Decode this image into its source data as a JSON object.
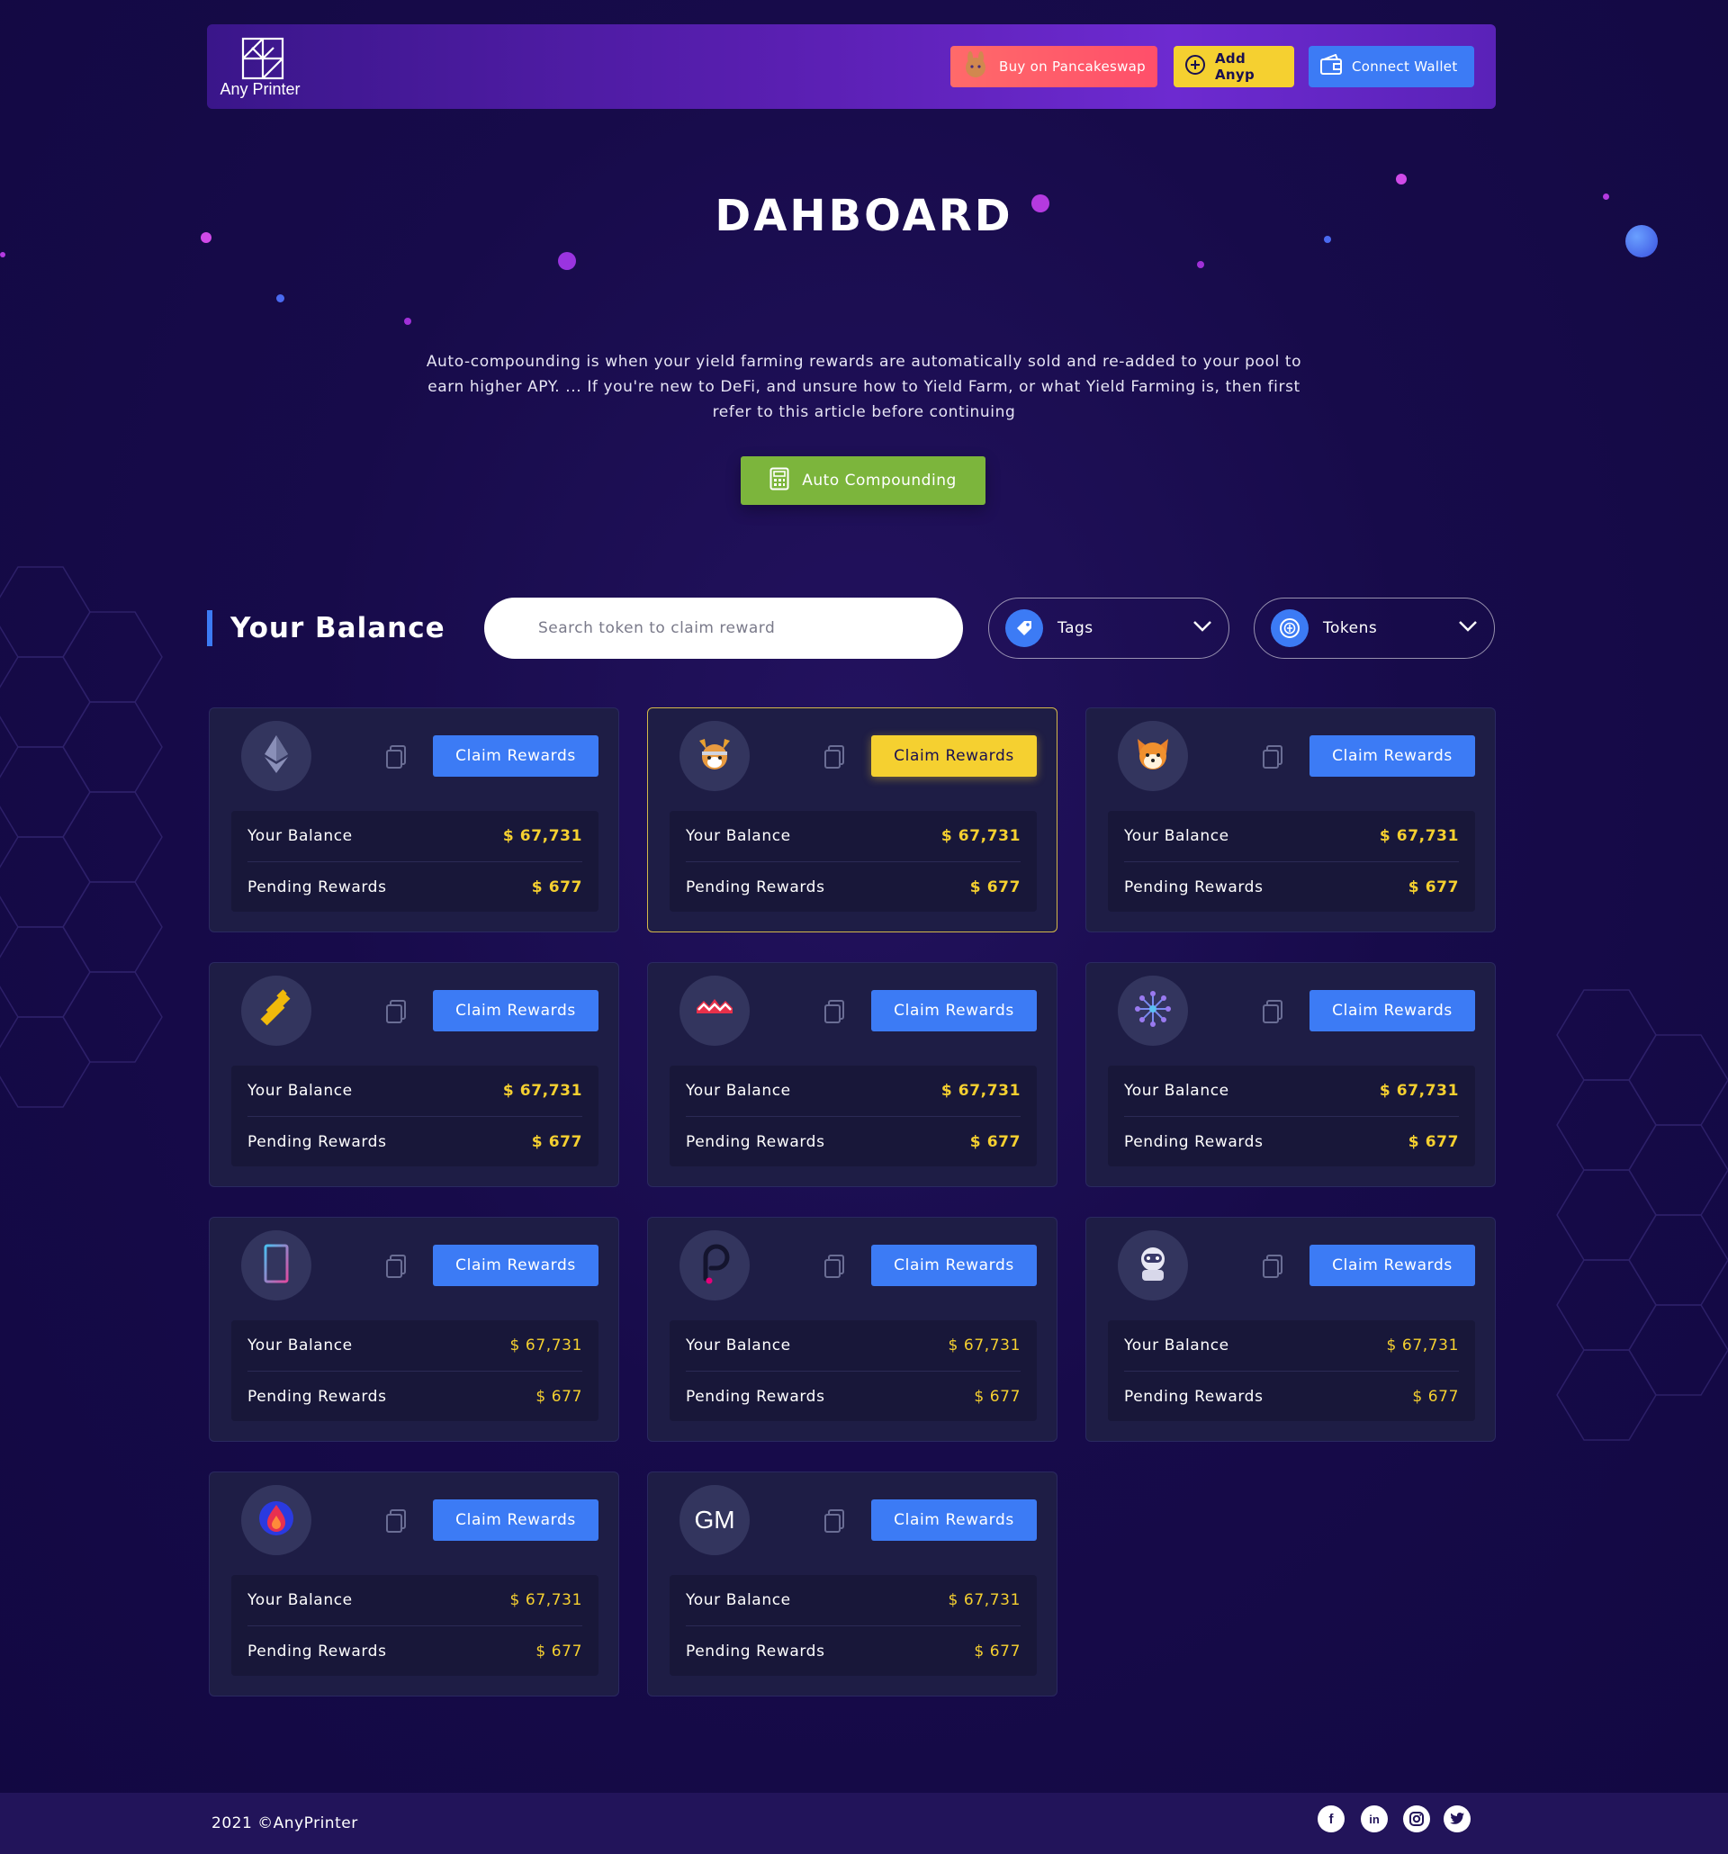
{
  "brand": {
    "logo_text": "Any Printer"
  },
  "header": {
    "pancake_label": "Buy on Pancakeswap",
    "add_label": "Add Anyp",
    "wallet_label": "Connect Wallet"
  },
  "hero": {
    "title": "DAHBOARD",
    "description": "Auto-compounding is when your yield farming rewards are automatically sold and re-added to your pool to earn higher APY. ... If you're new to DeFi, and unsure how to Yield Farm, or what Yield Farming is, then first refer to this article before continuing",
    "button_label": "Auto Compounding"
  },
  "balance": {
    "heading": "Your Balance",
    "search_placeholder": "Search token to claim reward",
    "tags_label": "Tags",
    "tokens_label": "Tokens"
  },
  "cards": [
    {
      "icon": "ethereum-icon",
      "claim_label": "Claim Rewards",
      "balance_label": "Your Balance",
      "balance": "$ 67,731",
      "rewards_label": "Pending Rewards",
      "rewards": "$ 677"
    },
    {
      "icon": "floki-icon",
      "claim_label": "Claim Rewards",
      "balance_label": "Your Balance",
      "balance": "$ 67,731",
      "rewards_label": "Pending Rewards",
      "rewards": "$ 677"
    },
    {
      "icon": "shiba-icon",
      "claim_label": "Claim Rewards",
      "balance_label": "Your Balance",
      "balance": "$ 67,731",
      "rewards_label": "Pending Rewards",
      "rewards": "$ 677"
    },
    {
      "icon": "binance-icon",
      "claim_label": "Claim Rewards",
      "balance_label": "Your Balance",
      "balance": "$ 67,731",
      "rewards_label": "Pending Rewards",
      "rewards": "$ 677"
    },
    {
      "icon": "wave-token-icon",
      "claim_label": "Claim Rewards",
      "balance_label": "Your Balance",
      "balance": "$ 67,731",
      "rewards_label": "Pending Rewards",
      "rewards": "$ 677"
    },
    {
      "icon": "network-token-icon",
      "claim_label": "Claim Rewards",
      "balance_label": "Your Balance",
      "balance": "$ 67,731",
      "rewards_label": "Pending Rewards",
      "rewards": "$ 677"
    },
    {
      "icon": "tablet-token-icon",
      "claim_label": "Claim Rewards",
      "balance_label": "Your Balance",
      "balance": "$ 67,731",
      "rewards_label": "Pending Rewards",
      "rewards": "$ 677"
    },
    {
      "icon": "polkadot-icon",
      "claim_label": "Claim Rewards",
      "balance_label": "Your Balance",
      "balance": "$ 67,731",
      "rewards_label": "Pending Rewards",
      "rewards": "$ 677"
    },
    {
      "icon": "astronaut-token-icon",
      "claim_label": "Claim Rewards",
      "balance_label": "Your Balance",
      "balance": "$ 67,731",
      "rewards_label": "Pending Rewards",
      "rewards": "$ 677"
    },
    {
      "icon": "flame-token-icon",
      "claim_label": "Claim Rewards",
      "balance_label": "Your Balance",
      "balance": "$ 67,731",
      "rewards_label": "Pending Rewards",
      "rewards": "$ 677"
    },
    {
      "icon": "gm-token-icon",
      "icon_text": "GM",
      "claim_label": "Claim Rewards",
      "balance_label": "Your Balance",
      "balance": "$ 67,731",
      "rewards_label": "Pending Rewards",
      "rewards": "$ 677"
    }
  ],
  "footer": {
    "copyright": "2021 ©AnyPrinter"
  },
  "colors": {
    "accent_blue": "#3c7bf5",
    "accent_yellow": "#f5d030",
    "green": "#7cb53c",
    "background": "#170b4a"
  }
}
